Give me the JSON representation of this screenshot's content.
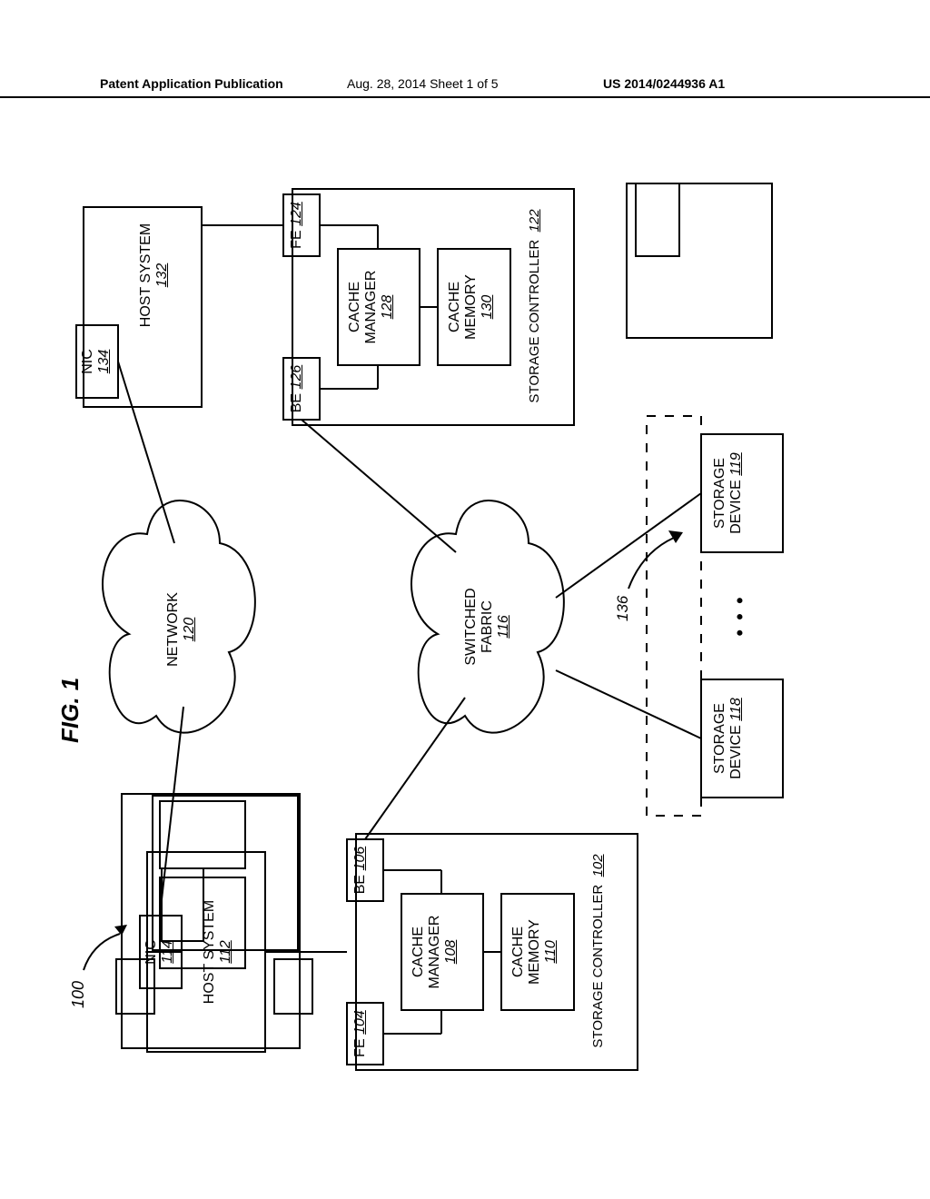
{
  "header": {
    "left": "Patent Application Publication",
    "mid": "Aug. 28, 2014  Sheet 1 of 5",
    "right": "US 2014/0244936 A1"
  },
  "figure": {
    "title": "FIG. 1",
    "system_ref": "100"
  },
  "clouds": {
    "network": {
      "label": "NETWORK",
      "num": "120"
    },
    "fabric": {
      "label": "SWITCHED",
      "label2": "FABRIC",
      "num": "116"
    }
  },
  "host_left": {
    "label": "HOST SYSTEM",
    "num": "112",
    "nic": {
      "label": "NIC",
      "num": "114"
    }
  },
  "host_right": {
    "label": "HOST SYSTEM",
    "num": "132",
    "nic": {
      "label": "NIC",
      "num": "134"
    }
  },
  "ctrl_left": {
    "label": "STORAGE",
    "label2": "CONTROLLER",
    "num": "102",
    "fe": {
      "label": "FE",
      "num": "104"
    },
    "be": {
      "label": "BE",
      "num": "106"
    },
    "cache_mgr": {
      "label": "CACHE",
      "label2": "MANAGER",
      "num": "108"
    },
    "cache_mem": {
      "label": "CACHE",
      "label2": "MEMORY",
      "num": "110"
    }
  },
  "ctrl_right": {
    "label": "STORAGE",
    "label2": "CONTROLLER",
    "num": "122",
    "fe": {
      "label": "FE",
      "num": "124"
    },
    "be": {
      "label": "BE",
      "num": "126"
    },
    "cache_mgr": {
      "label": "CACHE",
      "label2": "MANAGER",
      "num": "128"
    },
    "cache_mem": {
      "label": "CACHE",
      "label2": "MEMORY",
      "num": "130"
    }
  },
  "storage": {
    "dev1": {
      "label": "STORAGE",
      "label2": "DEVICE",
      "num": "118"
    },
    "dev2": {
      "label": "STORAGE",
      "label2": "DEVICE",
      "num": "119"
    },
    "ellipsis": "• • •",
    "group_ref": "136"
  }
}
